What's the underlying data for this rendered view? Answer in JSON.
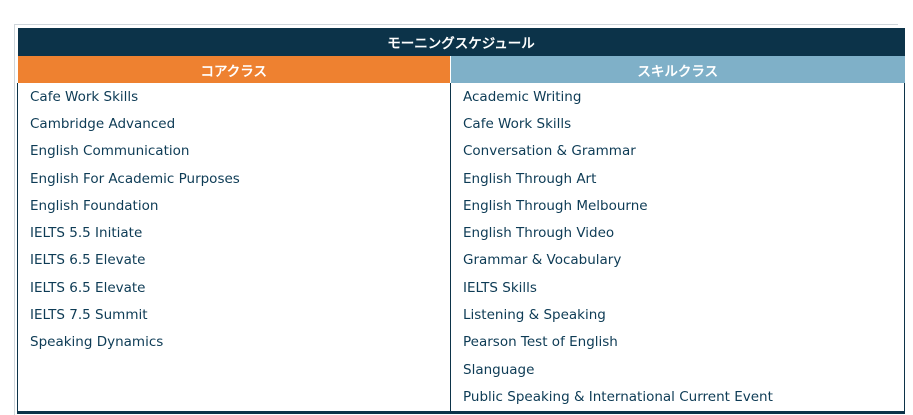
{
  "table": {
    "title": "モーニングスケジュール",
    "core_header": "コアクラス",
    "skill_header": "スキルクラス",
    "rows": [
      {
        "core": "Cafe Work Skills",
        "skill": "Academic Writing"
      },
      {
        "core": "Cambridge Advanced",
        "skill": "Cafe Work Skills"
      },
      {
        "core": "English Communication",
        "skill": "Conversation & Grammar"
      },
      {
        "core": "English For Academic Purposes",
        "skill": "English Through Art"
      },
      {
        "core": "English Foundation",
        "skill": "English Through Melbourne"
      },
      {
        "core": "IELTS 5.5 Initiate",
        "skill": "English Through Video"
      },
      {
        "core": "IELTS 6.5 Elevate",
        "skill": "Grammar & Vocabulary"
      },
      {
        "core": "IELTS 6.5 Elevate",
        "skill": "IELTS Skills"
      },
      {
        "core": "IELTS 7.5 Summit",
        "skill": "Listening & Speaking"
      },
      {
        "core": "Speaking Dynamics",
        "skill": "Pearson Test of English"
      },
      {
        "core": "",
        "skill": "Slanguage"
      },
      {
        "core": "",
        "skill": "Public Speaking & International Current Event"
      }
    ]
  },
  "colors": {
    "title_bg": "#0c3349",
    "core_header_bg": "#ee8130",
    "skill_header_bg": "#7fb0c8",
    "text": "#0d3b55"
  }
}
